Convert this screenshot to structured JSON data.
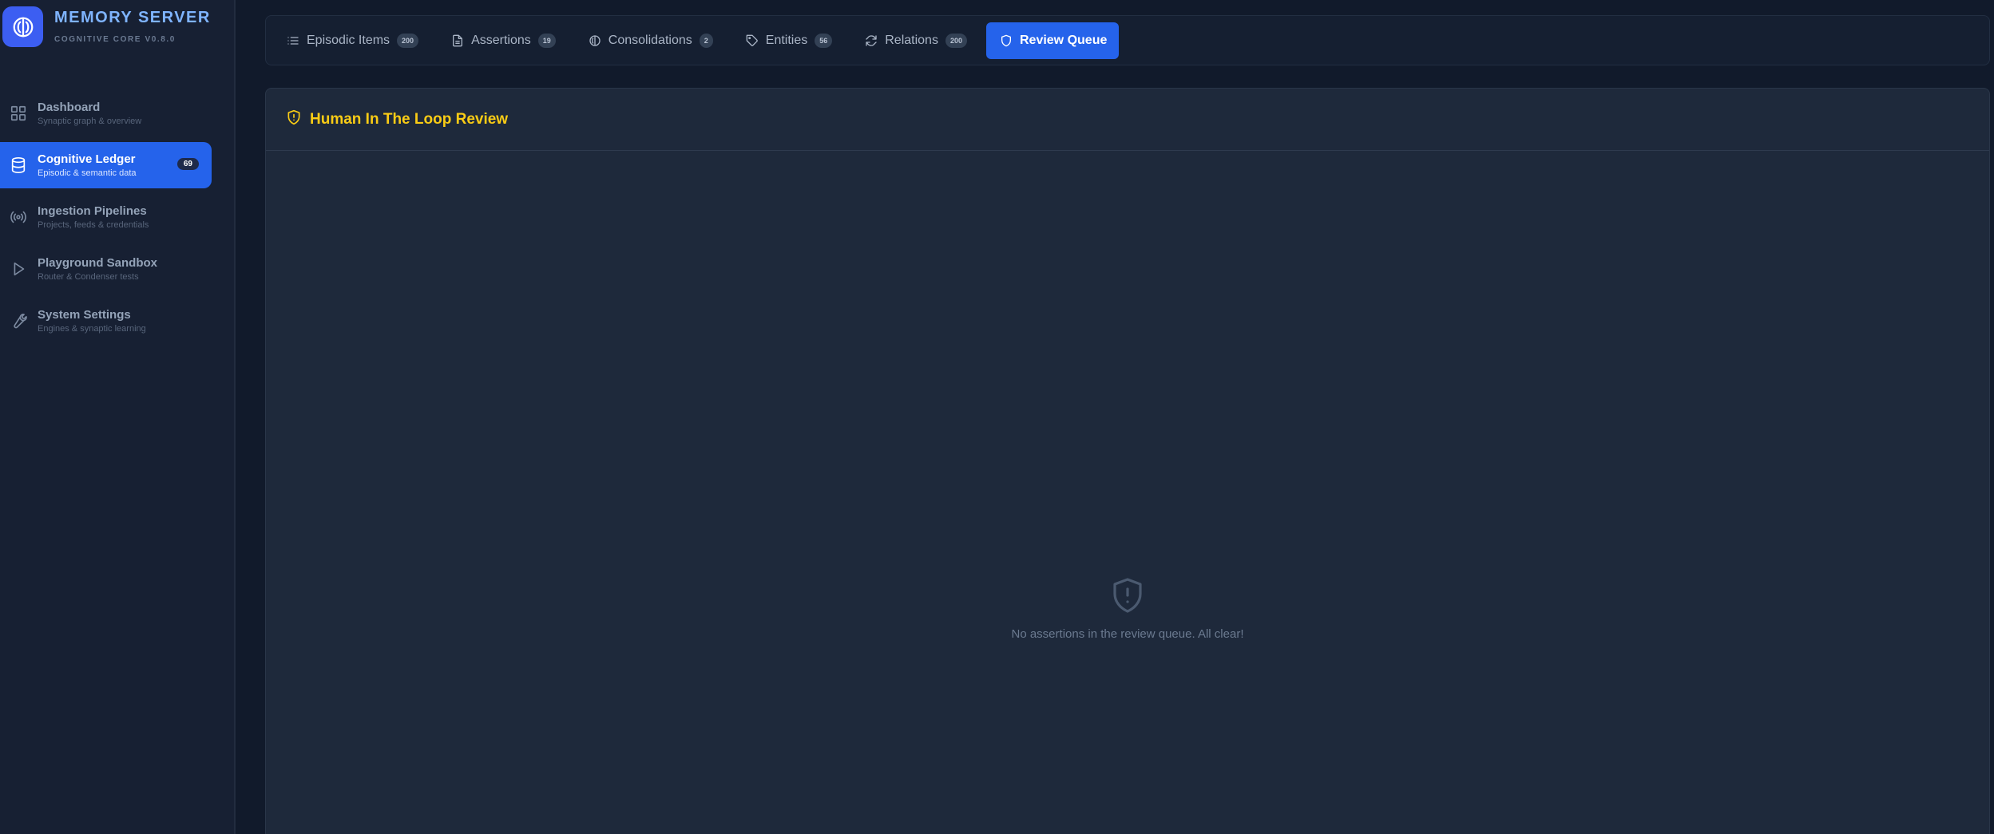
{
  "brand": {
    "title": "MEMORY SERVER",
    "subtitle": "COGNITIVE CORE V0.8.0"
  },
  "sidebar": {
    "items": [
      {
        "label": "Dashboard",
        "desc": "Synaptic graph & overview",
        "icon": "grid-icon",
        "active": false
      },
      {
        "label": "Cognitive Ledger",
        "desc": "Episodic & semantic data",
        "icon": "database-icon",
        "active": true,
        "badge": "69"
      },
      {
        "label": "Ingestion Pipelines",
        "desc": "Projects, feeds & credentials",
        "icon": "broadcast-icon",
        "active": false
      },
      {
        "label": "Playground Sandbox",
        "desc": "Router & Condenser tests",
        "icon": "play-icon",
        "active": false
      },
      {
        "label": "System Settings",
        "desc": "Engines & synaptic learning",
        "icon": "wrench-icon",
        "active": false
      }
    ]
  },
  "tabs": [
    {
      "label": "Episodic Items",
      "count": "200",
      "icon": "list-icon"
    },
    {
      "label": "Assertions",
      "count": "19",
      "icon": "document-icon"
    },
    {
      "label": "Consolidations",
      "count": "2",
      "icon": "brain-icon"
    },
    {
      "label": "Entities",
      "count": "56",
      "icon": "tag-icon"
    },
    {
      "label": "Relations",
      "count": "200",
      "icon": "refresh-icon"
    },
    {
      "label": "Review Queue",
      "icon": "shield-icon",
      "active": true
    }
  ],
  "panel": {
    "title": "Human In The Loop Review",
    "empty_text": "No assertions in the review queue. All clear!"
  },
  "colors": {
    "accent": "#2563eb",
    "brand_title": "#7fb4ff",
    "warning_title": "#facc15",
    "background": "#111a2b",
    "panel": "#1e293b"
  }
}
